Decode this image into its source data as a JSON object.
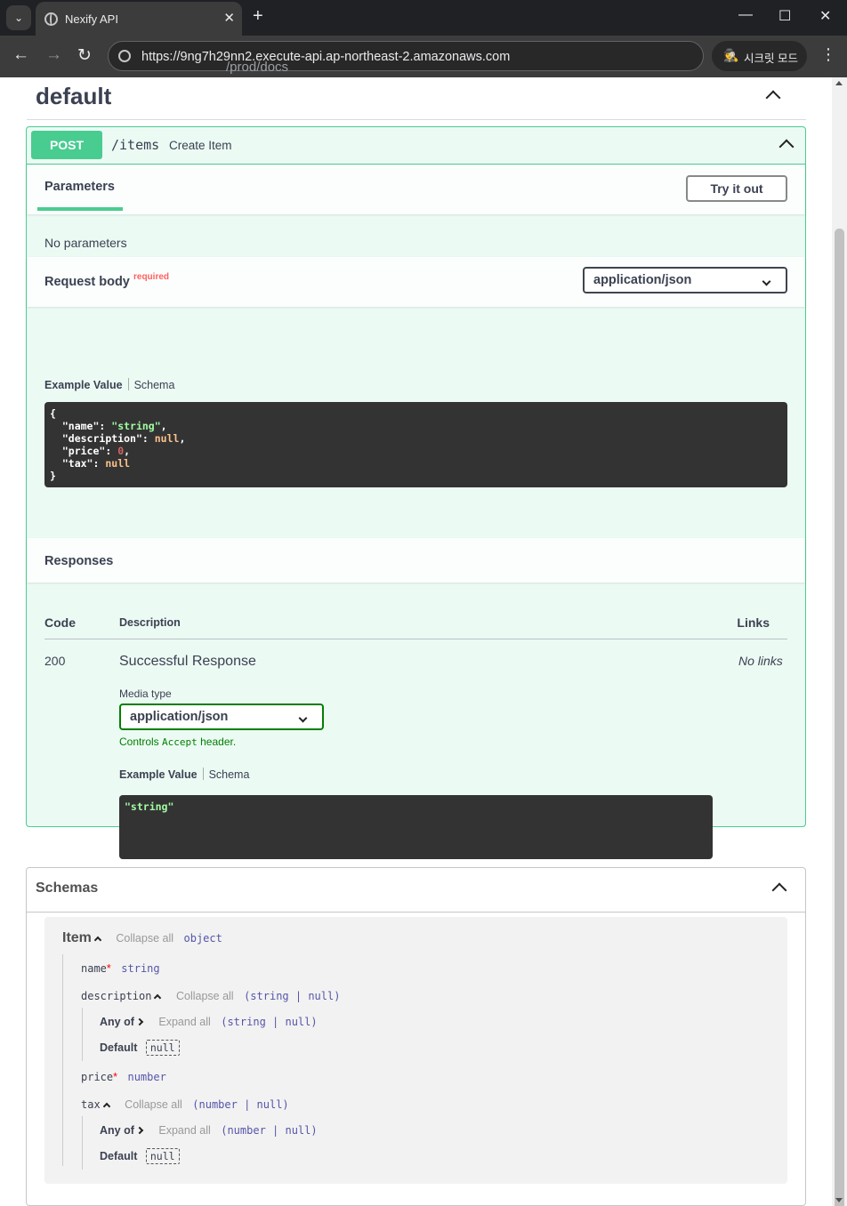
{
  "browser": {
    "tab_title": "Nexify API",
    "url_host": "https://9ng7h29nn2.execute-api.ap-northeast-2.amazonaws.com",
    "url_path": "/prod/docs",
    "incognito_label": "시크릿 모드"
  },
  "tag": {
    "title": "default"
  },
  "operation": {
    "method": "POST",
    "path": "/items",
    "summary": "Create Item",
    "parameters_tab": "Parameters",
    "try_button": "Try it out",
    "no_parameters": "No parameters",
    "request_body_label": "Request body",
    "required_label": "required",
    "content_type": "application/json",
    "example_tab": "Example Value",
    "schema_tab": "Schema",
    "request_example": {
      "name_key": "\"name\"",
      "name_val": "\"string\"",
      "description_key": "\"description\"",
      "description_val": "null",
      "price_key": "\"price\"",
      "price_val": "0",
      "tax_key": "\"tax\"",
      "tax_val": "null"
    },
    "responses_label": "Responses",
    "responses_table": {
      "col_code": "Code",
      "col_description": "Description",
      "col_links": "Links"
    },
    "response": {
      "code": "200",
      "description": "Successful Response",
      "links": "No links",
      "media_type_label": "Media type",
      "media_type": "application/json",
      "controls_pre": "Controls",
      "controls_code": "Accept",
      "controls_post": "header.",
      "example_value": "\"string\""
    }
  },
  "schemas": {
    "title": "Schemas",
    "model": {
      "name": "Item",
      "collapse_all": "Collapse all",
      "expand_all": "Expand all",
      "type": "object",
      "any_of": "Any of",
      "default_label": "Default",
      "properties": [
        {
          "name": "name",
          "required": true,
          "type": "string"
        },
        {
          "name": "description",
          "required": false,
          "type": "(string | null)",
          "default": "null"
        },
        {
          "name": "price",
          "required": true,
          "type": "number"
        },
        {
          "name": "tax",
          "required": false,
          "type": "(number | null)",
          "default": "null"
        }
      ]
    }
  }
}
